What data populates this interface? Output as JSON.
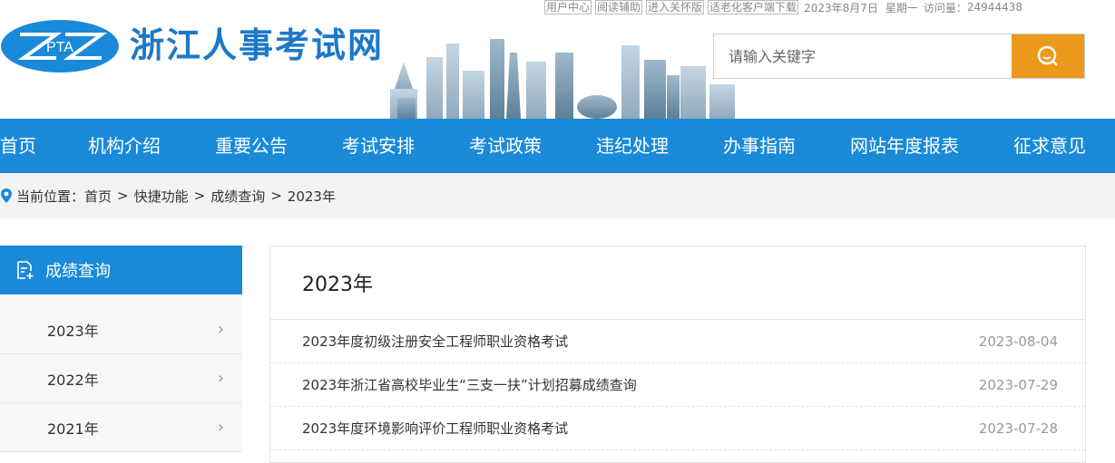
{
  "top_links": [
    "用户中心",
    "阅读辅助",
    "进入关怀版",
    "适老化客户端下载"
  ],
  "date_text": "2023年8月7日",
  "weekday_text": "星期一",
  "visits_label": "访问量：",
  "visits_count": "24944438",
  "logo_text": "PTA",
  "site_title": "浙江人事考试网",
  "search": {
    "placeholder": "请输入关键字"
  },
  "nav": [
    "首页",
    "机构介绍",
    "重要公告",
    "考试安排",
    "考试政策",
    "违纪处理",
    "办事指南",
    "网站年度报表",
    "征求意见"
  ],
  "breadcrumb": {
    "prefix": "当前位置：",
    "items": [
      "首页",
      "快捷功能",
      "成绩查询",
      "2023年"
    ],
    "separator": ">"
  },
  "sidebar": {
    "title": "成绩查询",
    "items": [
      "2023年",
      "2022年",
      "2021年"
    ]
  },
  "main": {
    "title": "2023年",
    "articles": [
      {
        "title": "2023年度初级注册安全工程师职业资格考试",
        "date": "2023-08-04"
      },
      {
        "title": "2023年浙江省高校毕业生“三支一扶”计划招募成绩查询",
        "date": "2023-07-29"
      },
      {
        "title": "2023年度环境影响评价工程师职业资格考试",
        "date": "2023-07-28"
      }
    ]
  },
  "colors": {
    "primary": "#1a8ad8",
    "search_button": "#ec9a1b",
    "title_blue": "#1e78c8"
  }
}
